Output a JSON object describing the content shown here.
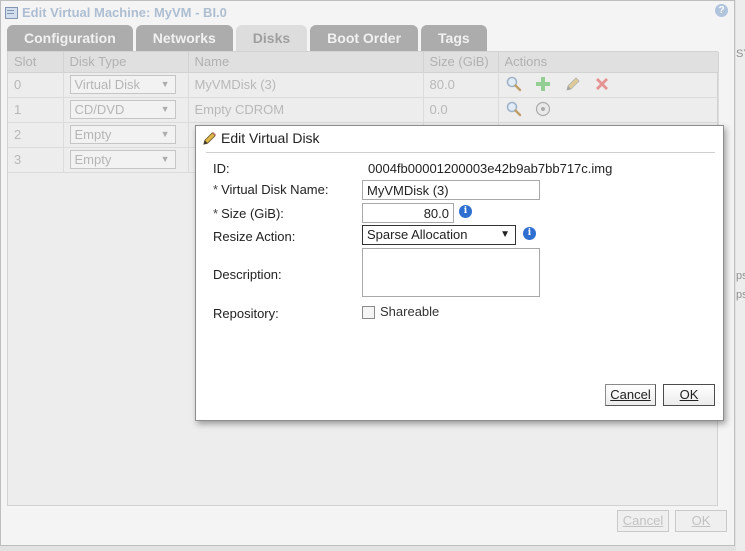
{
  "window": {
    "title": "Edit Virtual Machine: MyVM - BI.0",
    "help": "?",
    "tabs": [
      {
        "label": "Configuration",
        "active": false
      },
      {
        "label": "Networks",
        "active": false
      },
      {
        "label": "Disks",
        "active": true
      },
      {
        "label": "Boot Order",
        "active": false
      },
      {
        "label": "Tags",
        "active": false
      }
    ],
    "table": {
      "headers": [
        "Slot",
        "Disk Type",
        "Name",
        "Size (GiB)",
        "Actions"
      ],
      "rows": [
        {
          "slot": "0",
          "type": "Virtual Disk",
          "name": "MyVMDisk (3)",
          "size": "80.0"
        },
        {
          "slot": "1",
          "type": "CD/DVD",
          "name": "Empty CDROM",
          "size": "0.0"
        },
        {
          "slot": "2",
          "type": "Empty",
          "name": "",
          "size": ""
        },
        {
          "slot": "3",
          "type": "Empty",
          "name": "",
          "size": ""
        }
      ]
    },
    "cancel_label": "Cancel",
    "ok_label": "OK",
    "right_edge_text": [
      "SY",
      "ps",
      "ps"
    ]
  },
  "dialog": {
    "title": "Edit Virtual Disk",
    "id_label": "ID:",
    "id_value": "0004fb00001200003e42b9ab7bb717c.img",
    "name_required": "*",
    "name_label": "Virtual Disk Name:",
    "name_value": "MyVMDisk (3)",
    "size_required": "*",
    "size_label": "Size (GiB):",
    "size_value": "80.0",
    "resize_label": "Resize Action:",
    "resize_value": "Sparse Allocation",
    "description_label": "Description:",
    "description_value": "",
    "repository_label": "Repository:",
    "shareable_label": "Shareable",
    "shareable_checked": false,
    "cancel_label": "Cancel",
    "ok_label": "OK",
    "info_glyph": "i"
  },
  "colors": {
    "accent_blue": "#2f6fcf",
    "add_green": "#3aa83a",
    "delete_red": "#d23b3b"
  }
}
